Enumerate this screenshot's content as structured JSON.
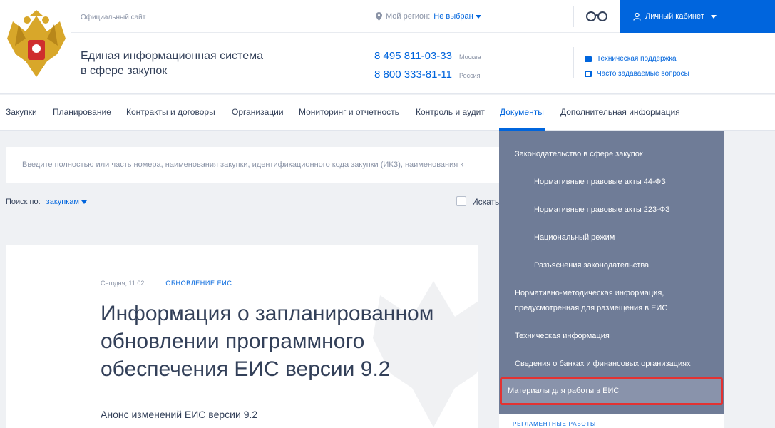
{
  "header": {
    "official_site": "Официальный сайт",
    "region_label": "Мой регион:",
    "region_value": "Не выбран",
    "cabinet_label": "Личный кабинет",
    "site_title_line1": "Единая информационная система",
    "site_title_line2": "в сфере закупок",
    "phones": [
      {
        "number": "8 495 811-03-33",
        "city": "Москва"
      },
      {
        "number": "8 800 333-81-11",
        "city": "Россия"
      }
    ],
    "support": [
      "Техническая поддержка",
      "Часто задаваемые вопросы"
    ]
  },
  "nav": {
    "items": [
      "Закупки",
      "Планирование",
      "Контракты и договоры",
      "Организации",
      "Мониторинг и отчетность",
      "Контроль и аудит",
      "Документы",
      "Дополнительная информация"
    ],
    "active": "Документы"
  },
  "search": {
    "placeholder": "Введите полностью или часть номера, наименования закупки, идентификационного кода закупки (ИКЗ), наименования к",
    "search_by_label": "Поиск по:",
    "search_by_value": "закупкам",
    "checkbox_label": "Искать"
  },
  "news": {
    "date": "Сегодня, 11:02",
    "tag": "ОБНОВЛЕНИЕ ЕИС",
    "title_line1": "Информация о запланированном",
    "title_line2": "обновлении программного",
    "title_line3": "обеспечения ЕИС версии 9.2",
    "subtitle": "Анонс изменений ЕИС версии 9.2"
  },
  "dropdown": {
    "items": [
      "Законодательство в сфере закупок",
      "Нормативные правовые акты 44-ФЗ",
      "Нормативные правовые акты 223-ФЗ",
      "Национальный режим",
      "Разъяснения законодательства",
      "Нормативно-методическая информация,",
      "предусмотренная для размещения в ЕИС",
      "Техническая информация",
      "Сведения о банках и финансовых организациях"
    ],
    "highlighted": "Материалы для работы в ЕИС",
    "below": "РЕГЛАМЕНТНЫЕ РАБОТЫ"
  },
  "colors": {
    "accent": "#0065dd",
    "dropdown_bg": "#6f7c97",
    "highlight_border": "#e23232"
  }
}
